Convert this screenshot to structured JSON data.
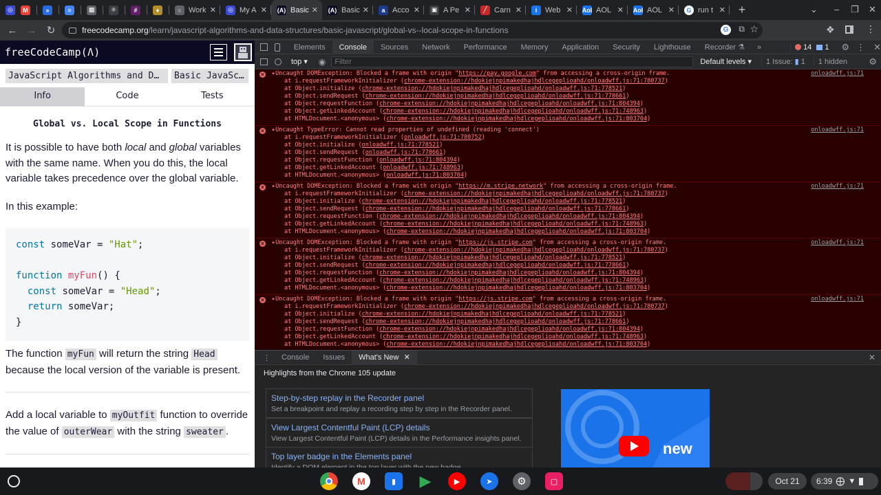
{
  "browser": {
    "tabs": [
      {
        "title": "",
        "fav": "◎",
        "color": "#3c4bd6"
      },
      {
        "title": "",
        "fav": "M",
        "color": "#ea4335"
      },
      {
        "title": "",
        "fav": "»",
        "color": "#2a6be0"
      },
      {
        "title": "",
        "fav": "≡",
        "color": "#4285f4"
      },
      {
        "title": "",
        "fav": "▩",
        "color": "#5f6368"
      },
      {
        "title": "",
        "fav": "⚛",
        "color": "#3c4043"
      },
      {
        "title": "",
        "fav": "#",
        "color": "#611f69"
      },
      {
        "title": "",
        "fav": "♦",
        "color": "#b28d2a"
      },
      {
        "title": "Work",
        "fav": "○",
        "color": "#5f6368"
      },
      {
        "title": "My A",
        "fav": "◎",
        "color": "#3c4bd6"
      },
      {
        "title": "Basic",
        "fav": "(A)",
        "color": "#0a0a23"
      },
      {
        "title": "Basic",
        "fav": "(A)",
        "color": "#0a0a23"
      },
      {
        "title": "Acco",
        "fav": "a",
        "color": "#1e3a8a"
      },
      {
        "title": "A Pe",
        "fav": "▣",
        "color": "#3c4043"
      },
      {
        "title": "Carn",
        "fav": "╱",
        "color": "#c62828"
      },
      {
        "title": "Web",
        "fav": "i",
        "color": "#1a73e8"
      },
      {
        "title": "AOL",
        "fav": "Aol",
        "color": "#1a73e8"
      },
      {
        "title": "AOL",
        "fav": "Aol",
        "color": "#1a73e8"
      },
      {
        "title": "run t",
        "fav": "G",
        "color": "#ffffff"
      }
    ],
    "url_host": "freecodecamp.org",
    "url_path": "/learn/javascript-algorithms-and-data-structures/basic-javascript/global-vs--local-scope-in-functions"
  },
  "fcc": {
    "logo": "freeCodeCamp(Ʌ)",
    "breadcrumb": [
      "JavaScript Algorithms and D…",
      "Basic JavaSc…"
    ],
    "tabs": [
      "Info",
      "Code",
      "Tests"
    ],
    "title": "Global vs. Local Scope in Functions",
    "p1_a": "It is possible to have both ",
    "p1_local": "local",
    "p1_b": " and ",
    "p1_global": "global",
    "p1_c": " variables with the same name. When you do this, the local variable takes precedence over the global variable.",
    "p2": "In this example:",
    "code": {
      "l1_kw": "const",
      "l1_rest": " someVar = ",
      "l1_str": "\"Hat\"",
      "l1_end": ";",
      "l3_kw": "function",
      "l3_fn": "myFun",
      "l3_end": "() {",
      "l4_kw": "const",
      "l4_rest": " someVar = ",
      "l4_str": "\"Head\"",
      "l4_end": ";",
      "l5_kw": "return",
      "l5_rest": " someVar;",
      "l6": "}"
    },
    "p3_a": "The function ",
    "p3_code1": "myFun",
    "p3_b": " will return the string ",
    "p3_code2": "Head",
    "p3_c": " because the local version of the variable is present.",
    "p4_a": "Add a local variable to ",
    "p4_code1": "myOutfit",
    "p4_b": " function to override the value of ",
    "p4_code2": "outerWear",
    "p4_c": " with the string ",
    "p4_code3": "sweater",
    "p4_d": "."
  },
  "devtools": {
    "tabs": [
      "Elements",
      "Console",
      "Sources",
      "Network",
      "Performance",
      "Memory",
      "Application",
      "Security",
      "Lighthouse",
      "Recorder ⚗"
    ],
    "error_count": "14",
    "message_count": "1",
    "context": "top",
    "filter_placeholder": "Filter",
    "levels": "Default levels",
    "issues": "1 Issue: ",
    "issues_count": "1",
    "hidden": "1 hidden",
    "logs": [
      {
        "header": "▸Uncaught DOMException: Blocked a frame with origin \"https://pay.google.com\" from accessing a cross-origin frame.",
        "src": "onloadwff.js:71",
        "stack": [
          "at i.requestFrameworkInitializer (chrome-extension://hdokiejnpimakedhajhdlcegeplioahd/onloadwff.js:71:780737)",
          "at Object.initialize (chrome-extension://hdokiejnpimakedhajhdlcegeplioahd/onloadwff.js:71:778521)",
          "at Object.sendRequest (chrome-extension://hdokiejnpimakedhajhdlcegeplioahd/onloadwff.js:71:778661)",
          "at Object.requestFunction (chrome-extension://hdokiejnpimakedhajhdlcegeplioahd/onloadwff.js:71:804394)",
          "at Object.getLinkedAccount (chrome-extension://hdokiejnpimakedhajhdlcegeplioahd/onloadwff.js:71:748963)",
          "at HTMLDocument.<anonymous> (chrome-extension://hdokiejnpimakedhajhdlcegeplioahd/onloadwff.js:71:803704)"
        ]
      },
      {
        "header": "▸Uncaught TypeError: Cannot read properties of undefined (reading 'connect')",
        "src": "onloadwff.js:71",
        "stack": [
          "at i.requestFrameworkInitializer (onloadwff.js:71:780752)",
          "at Object.initialize (onloadwff.js:71:778521)",
          "at Object.sendRequest (onloadwff.js:71:778661)",
          "at Object.requestFunction (onloadwff.js:71:804394)",
          "at Object.getLinkedAccount (onloadwff.js:71:748963)",
          "at HTMLDocument.<anonymous> (onloadwff.js:71:803704)"
        ]
      },
      {
        "header": "▸Uncaught DOMException: Blocked a frame with origin \"https://m.stripe.network\" from accessing a cross-origin frame.",
        "src": "onloadwff.js:71",
        "stack": [
          "at i.requestFrameworkInitializer (chrome-extension://hdokiejnpimakedhajhdlcegeplioahd/onloadwff.js:71:780737)",
          "at Object.initialize (chrome-extension://hdokiejnpimakedhajhdlcegeplioahd/onloadwff.js:71:778521)",
          "at Object.sendRequest (chrome-extension://hdokiejnpimakedhajhdlcegeplioahd/onloadwff.js:71:778661)",
          "at Object.requestFunction (chrome-extension://hdokiejnpimakedhajhdlcegeplioahd/onloadwff.js:71:804394)",
          "at Object.getLinkedAccount (chrome-extension://hdokiejnpimakedhajhdlcegeplioahd/onloadwff.js:71:748963)",
          "at HTMLDocument.<anonymous> (chrome-extension://hdokiejnpimakedhajhdlcegeplioahd/onloadwff.js:71:803704)"
        ]
      },
      {
        "header": "▸Uncaught DOMException: Blocked a frame with origin \"https://js.stripe.com\" from accessing a cross-origin frame.",
        "src": "onloadwff.js:71",
        "stack": [
          "at i.requestFrameworkInitializer (chrome-extension://hdokiejnpimakedhajhdlcegeplioahd/onloadwff.js:71:780737)",
          "at Object.initialize (chrome-extension://hdokiejnpimakedhajhdlcegeplioahd/onloadwff.js:71:778521)",
          "at Object.sendRequest (chrome-extension://hdokiejnpimakedhajhdlcegeplioahd/onloadwff.js:71:778661)",
          "at Object.requestFunction (chrome-extension://hdokiejnpimakedhajhdlcegeplioahd/onloadwff.js:71:804394)",
          "at Object.getLinkedAccount (chrome-extension://hdokiejnpimakedhajhdlcegeplioahd/onloadwff.js:71:748963)",
          "at HTMLDocument.<anonymous> (chrome-extension://hdokiejnpimakedhajhdlcegeplioahd/onloadwff.js:71:803704)"
        ]
      },
      {
        "header": "▸Uncaught DOMException: Blocked a frame with origin \"https://js.stripe.com\" from accessing a cross-origin frame.",
        "src": "onloadwff.js:71",
        "stack": [
          "at i.requestFrameworkInitializer (chrome-extension://hdokiejnpimakedhajhdlcegeplioahd/onloadwff.js:71:780737)",
          "at Object.initialize (chrome-extension://hdokiejnpimakedhajhdlcegeplioahd/onloadwff.js:71:778521)",
          "at Object.sendRequest (chrome-extension://hdokiejnpimakedhajhdlcegeplioahd/onloadwff.js:71:778661)",
          "at Object.requestFunction (chrome-extension://hdokiejnpimakedhajhdlcegeplioahd/onloadwff.js:71:804394)",
          "at Object.getLinkedAccount (chrome-extension://hdokiejnpimakedhajhdlcegeplioahd/onloadwff.js:71:748963)",
          "at HTMLDocument.<anonymous> (chrome-extension://hdokiejnpimakedhajhdlcegeplioahd/onloadwff.js:71:803704)"
        ]
      }
    ],
    "drawer_tabs": [
      "Console",
      "Issues",
      "What's New"
    ],
    "whats_new_title": "Highlights from the Chrome 105 update",
    "cards": [
      {
        "title": "Step-by-step replay in the Recorder panel",
        "desc": "Set a breakpoint and replay a recording step by step in the Recorder panel."
      },
      {
        "title": "View Largest Contentful Paint (LCP) details",
        "desc": "View Largest Contentful Paint (LCP) details in the Performance insights panel."
      },
      {
        "title": "Top layer badge in the Elements panel",
        "desc": "Identify a DOM element in the top layer with the new badge."
      }
    ],
    "video_label": "new"
  },
  "shelf": {
    "date": "Oct 21",
    "time": "6:39"
  }
}
